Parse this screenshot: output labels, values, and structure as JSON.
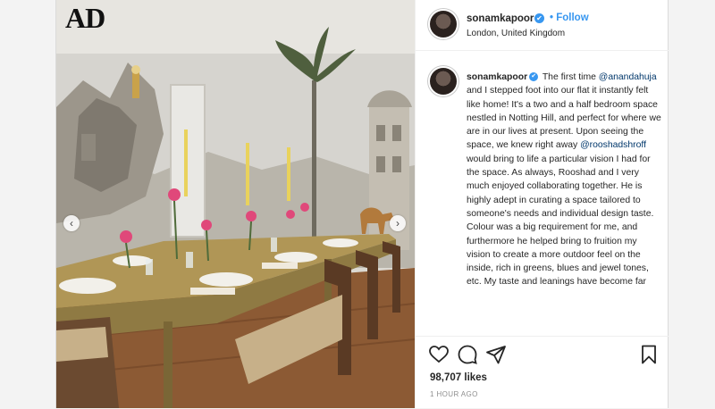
{
  "media": {
    "brand_logo": "AD",
    "prev_arrow": "‹",
    "next_arrow": "›"
  },
  "header": {
    "username": "sonamkapoor",
    "verified_mark": "✔",
    "separator": "•",
    "follow_label": "Follow",
    "location": "London, United Kingdom"
  },
  "caption": {
    "username": "sonamkapoor",
    "verified_mark": "✔",
    "text_1": " The first time ",
    "mention_1": "@anandahuja",
    "text_2": " and I stepped foot into our flat it instantly felt like home! It's a two and a half bedroom space nestled in Notting Hill, and perfect for where we are in our lives at present. Upon seeing the space, we knew right away ",
    "mention_2": "@rooshadshroff",
    "text_3": " would bring to life a particular vision I had for the space. As always, Rooshad and I very much enjoyed collaborating together. He is highly adept in curating a space tailored to someone's needs and individual design taste. Colour was a big requirement for me, and furthermore he helped bring to fruition my vision to create a more outdoor feel on the inside, rich in greens, blues and jewel tones, etc. My taste and leanings have become far"
  },
  "actions": {
    "icons": [
      "heart-icon",
      "comment-icon",
      "share-icon",
      "bookmark-icon"
    ],
    "likes": "98,707 likes",
    "time": "1 HOUR AGO"
  },
  "colors": {
    "link_blue": "#3897f0",
    "mention_blue": "#00376b",
    "text": "#262626",
    "muted": "#8e8e8e"
  }
}
